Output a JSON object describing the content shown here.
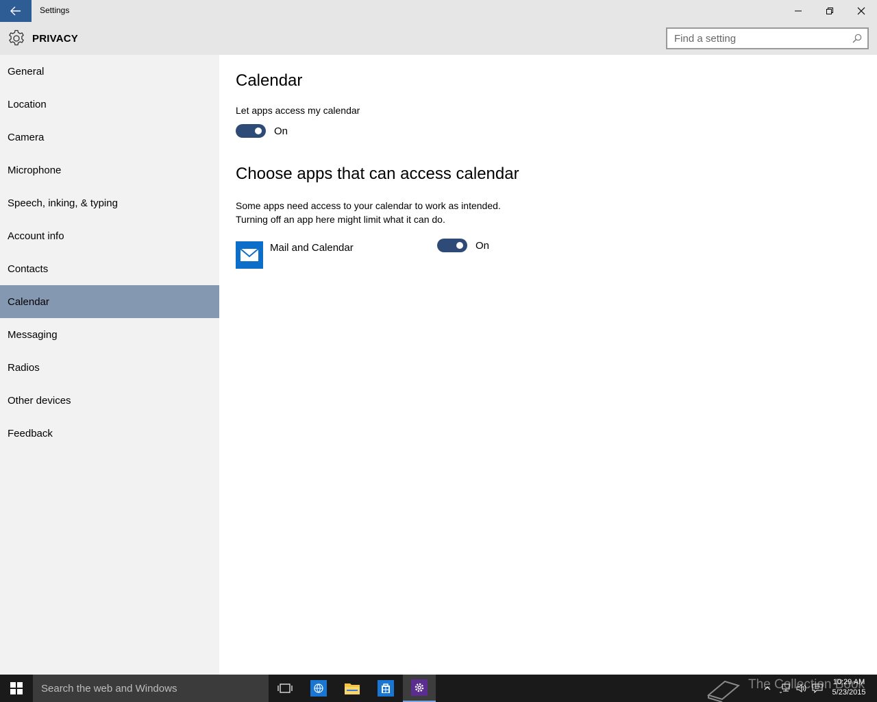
{
  "window": {
    "title": "Settings"
  },
  "header": {
    "section_title": "PRIVACY",
    "search_placeholder": "Find a setting"
  },
  "sidebar": {
    "items": [
      {
        "label": "General"
      },
      {
        "label": "Location"
      },
      {
        "label": "Camera"
      },
      {
        "label": "Microphone"
      },
      {
        "label": "Speech, inking, & typing"
      },
      {
        "label": "Account info"
      },
      {
        "label": "Contacts"
      },
      {
        "label": "Calendar",
        "selected": true
      },
      {
        "label": "Messaging"
      },
      {
        "label": "Radios"
      },
      {
        "label": "Other devices"
      },
      {
        "label": "Feedback"
      }
    ]
  },
  "main": {
    "title": "Calendar",
    "access_label": "Let apps access my calendar",
    "access_toggle": {
      "state": "On"
    },
    "choose_title": "Choose apps that can access calendar",
    "description_line1": "Some apps need access to your calendar to work as intended.",
    "description_line2": "Turning off an app here might limit what it can do.",
    "apps": [
      {
        "name": "Mail and Calendar",
        "icon": "mail-icon",
        "toggle_state": "On"
      }
    ]
  },
  "taskbar": {
    "search_placeholder": "Search the web and Windows",
    "watermark": "The Collection Book",
    "time": "10:29 AM",
    "date": "5/23/2015"
  },
  "colors": {
    "accent": "#2e5c94",
    "selected_nav": "#8598b2",
    "toggle_on": "#2e4b77",
    "app_tile": "#0d6ec9",
    "taskbar": "#1a1a1a"
  }
}
